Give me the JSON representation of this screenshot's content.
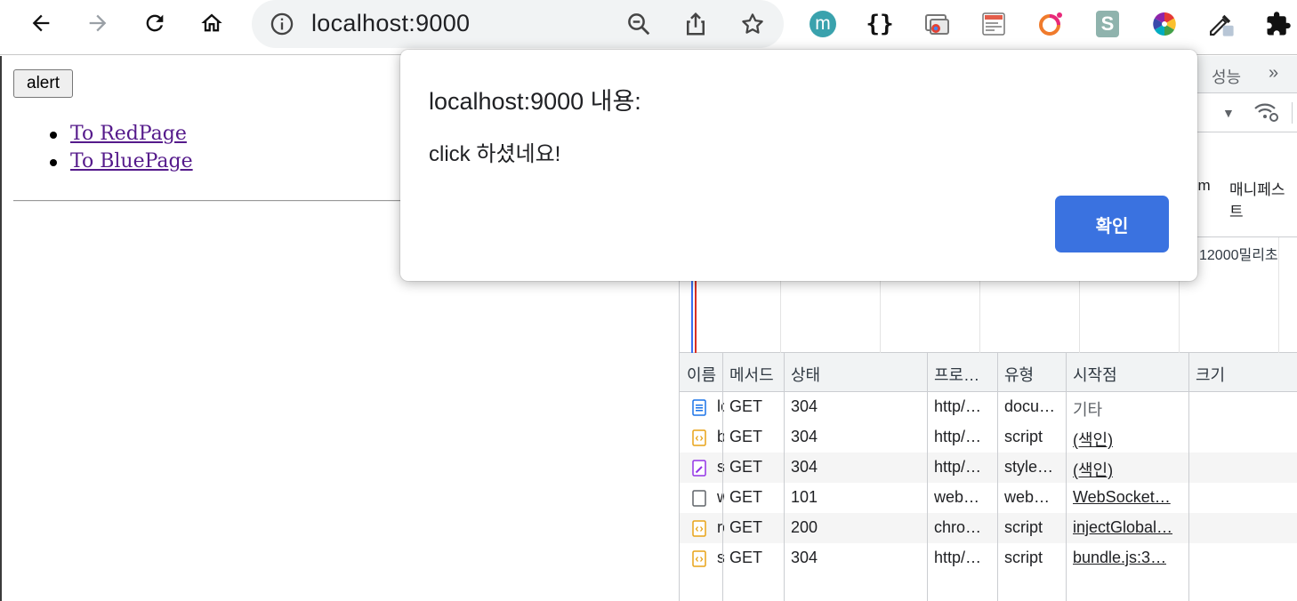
{
  "browser": {
    "url": "localhost:9000"
  },
  "page": {
    "alert_button": "alert",
    "links": [
      "To RedPage",
      "To BluePage"
    ]
  },
  "devtools": {
    "tab_performance": "성능",
    "more_tabs": "»",
    "filter_wasm": "sm",
    "filter_manifest": "매니페스트",
    "timeline_label": "12000밀리초",
    "columns": [
      "이름",
      "메서드",
      "상태",
      "프로…",
      "유형",
      "시작점",
      "크기"
    ],
    "rows": [
      {
        "name": "lo",
        "method": "GET",
        "status": "304",
        "protocol": "http/…",
        "type": "docu…",
        "initiator": "기타",
        "icon": "document-icon"
      },
      {
        "name": "bu",
        "method": "GET",
        "status": "304",
        "protocol": "http/…",
        "type": "script",
        "initiator": "(색인)",
        "icon": "script-icon"
      },
      {
        "name": "st",
        "method": "GET",
        "status": "304",
        "protocol": "http/…",
        "type": "style…",
        "initiator": "(색인)",
        "icon": "stylesheet-icon"
      },
      {
        "name": "ws",
        "method": "GET",
        "status": "101",
        "protocol": "web…",
        "type": "web…",
        "initiator": "WebSocket…",
        "icon": "websocket-icon"
      },
      {
        "name": "re",
        "method": "GET",
        "status": "200",
        "protocol": "chro…",
        "type": "script",
        "initiator": "injectGlobal…",
        "icon": "script-icon"
      },
      {
        "name": "so",
        "method": "GET",
        "status": "304",
        "protocol": "http/…",
        "type": "script",
        "initiator": "bundle.js:3…",
        "icon": "script-icon"
      }
    ]
  },
  "dialog": {
    "title": "localhost:9000 내용:",
    "message": "click 하셨네요!",
    "ok_label": "확인",
    "ok_color": "#3a72e0"
  }
}
